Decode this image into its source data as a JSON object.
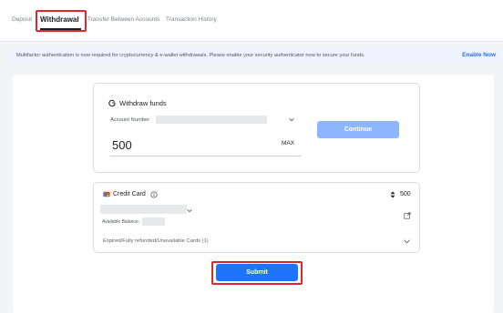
{
  "tabs": [
    {
      "label": "Deposit"
    },
    {
      "label": "Withdrawal",
      "active": true
    },
    {
      "label": "Transfer Between Accounts"
    },
    {
      "label": "Transaction History"
    }
  ],
  "banner": {
    "text": "Multifactor authentication is now required for cryptocurrency & e-wallet withdrawals. Please enable your security authenticator now to secure your funds.",
    "link": "Enable Now"
  },
  "withdraw": {
    "title": "Withdraw funds",
    "account_label": "Account Number",
    "amount": "500",
    "max_label": "MAX",
    "continue_label": "Continue"
  },
  "payment": {
    "method_label": "Credit Card",
    "amount": "500",
    "available_label": "Available Balance:",
    "expired_label": "Expired/Fully refunded/Unavailable Cards (1)"
  },
  "submit_label": "Submit",
  "colors": {
    "accent": "#1f74ff",
    "accent_disabled": "#8cb6ff",
    "highlight": "#e0262b",
    "banner_bg": "#eef4ff",
    "link": "#2f6fe0"
  },
  "icons": [
    "withdraw-icon",
    "chevron-down-icon",
    "credit-card-icon",
    "info-icon",
    "sort-icon",
    "external-link-icon"
  ]
}
